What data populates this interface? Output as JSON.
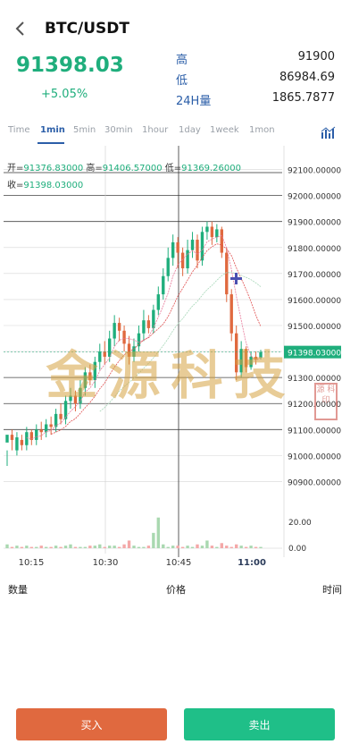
{
  "header": {
    "title": "BTC/USDT"
  },
  "ticker": {
    "last_price": "91398.03",
    "change_pct": "+5.05%",
    "high_label": "高",
    "high_value": "91900",
    "low_label": "低",
    "low_value": "86984.69",
    "vol_label": "24H量",
    "vol_value": "1865.7877"
  },
  "intervals": [
    "Time",
    "1min",
    "5min",
    "30min",
    "1hour",
    "1day",
    "1week",
    "1mon"
  ],
  "active_interval": "1min",
  "legend": {
    "open_label": "开=",
    "open_value": "91376.83000",
    "high_label": "高=",
    "high_value": "91406.57000",
    "low_label": "低=",
    "low_value": "91369.26000",
    "close_label": "收=",
    "close_value": "91398.03000"
  },
  "price_axis": [
    "92100.00000",
    "92000.00000",
    "91900.00000",
    "91800.00000",
    "91700.00000",
    "91600.00000",
    "91500.00000",
    "91400.00000",
    "91300.00000",
    "91200.00000",
    "91100.00000",
    "91000.00000",
    "90900.00000"
  ],
  "current_price_tag": "91398.03000",
  "volume_axis": [
    "20.00",
    "0.00"
  ],
  "time_axis": [
    "10:15",
    "10:30",
    "10:45",
    "11:00"
  ],
  "orderbook_headers": {
    "qty": "数量",
    "price": "价格",
    "time": "时间"
  },
  "buttons": {
    "buy": "买入",
    "sell": "卖出"
  },
  "watermark": {
    "text": "金源科技",
    "seal": "源 科 印"
  },
  "colors": {
    "up": "#1fae7c",
    "down": "#e0693f",
    "accent": "#2b5ea8"
  },
  "chart_data": {
    "type": "candlestick",
    "interval": "1min",
    "yrange": [
      90850,
      92150
    ],
    "time_labels": [
      "10:15",
      "10:30",
      "10:45",
      "11:00"
    ],
    "candles": [
      [
        91050,
        91080,
        91020,
        90960
      ],
      [
        91080,
        91060,
        91100,
        91020
      ],
      [
        91020,
        91070,
        91090,
        91000
      ],
      [
        91060,
        91040,
        91080,
        91020
      ],
      [
        91040,
        91090,
        91110,
        91020
      ],
      [
        91090,
        91060,
        91100,
        91040
      ],
      [
        91060,
        91100,
        91120,
        91040
      ],
      [
        91100,
        91090,
        91130,
        91060
      ],
      [
        91090,
        91120,
        91140,
        91070
      ],
      [
        91120,
        91110,
        91150,
        91080
      ],
      [
        91110,
        91160,
        91180,
        91090
      ],
      [
        91160,
        91140,
        91200,
        91120
      ],
      [
        91140,
        91210,
        91230,
        91120
      ],
      [
        91210,
        91230,
        91260,
        91180
      ],
      [
        91230,
        91200,
        91250,
        91170
      ],
      [
        91200,
        91260,
        91290,
        91180
      ],
      [
        91260,
        91320,
        91340,
        91230
      ],
      [
        91320,
        91290,
        91350,
        91270
      ],
      [
        91290,
        91360,
        91380,
        91260
      ],
      [
        91360,
        91400,
        91430,
        91330
      ],
      [
        91400,
        91380,
        91440,
        91350
      ],
      [
        91380,
        91450,
        91480,
        91360
      ],
      [
        91450,
        91510,
        91540,
        91420
      ],
      [
        91510,
        91480,
        91530,
        91440
      ],
      [
        91480,
        91430,
        91500,
        91400
      ],
      [
        91430,
        91380,
        91460,
        91350
      ],
      [
        91380,
        91420,
        91450,
        91360
      ],
      [
        91420,
        91470,
        91500,
        91400
      ],
      [
        91470,
        91520,
        91560,
        91440
      ],
      [
        91520,
        91490,
        91540,
        91470
      ],
      [
        91490,
        91560,
        91580,
        91470
      ],
      [
        91560,
        91620,
        91650,
        91540
      ],
      [
        91620,
        91690,
        91720,
        91600
      ],
      [
        91690,
        91760,
        91800,
        91670
      ],
      [
        91760,
        91820,
        91850,
        91730
      ],
      [
        91820,
        91780,
        91840,
        91720
      ],
      [
        91780,
        91720,
        91800,
        91690
      ],
      [
        91720,
        91790,
        91830,
        91700
      ],
      [
        91790,
        91830,
        91860,
        91760
      ],
      [
        91830,
        91750,
        91850,
        91720
      ],
      [
        91750,
        91860,
        91880,
        91730
      ],
      [
        91860,
        91880,
        91900,
        91830
      ],
      [
        91880,
        91840,
        91900,
        91810
      ],
      [
        91840,
        91870,
        91890,
        91820
      ],
      [
        91870,
        91780,
        91880,
        91760
      ],
      [
        91780,
        91620,
        91800,
        91590
      ],
      [
        91620,
        91470,
        91640,
        91440
      ],
      [
        91470,
        91320,
        91500,
        91290
      ],
      [
        91320,
        91410,
        91440,
        91300
      ],
      [
        91410,
        91340,
        91420,
        91320
      ],
      [
        91340,
        91380,
        91400,
        91330
      ],
      [
        91380,
        91370,
        91400,
        91350
      ],
      [
        91376.83,
        91398.03,
        91406.57,
        91369.26
      ]
    ],
    "volumes": [
      3,
      1,
      2,
      1,
      2,
      1,
      1,
      2,
      1,
      1,
      2,
      1,
      2,
      3,
      1,
      1,
      1,
      2,
      2,
      3,
      1,
      2,
      2,
      1,
      3,
      6,
      2,
      1,
      1,
      2,
      12,
      24,
      3,
      1,
      2,
      2,
      1,
      2,
      1,
      3,
      2,
      6,
      2,
      1,
      4,
      2,
      1,
      3,
      2,
      1,
      2,
      1,
      1
    ]
  }
}
